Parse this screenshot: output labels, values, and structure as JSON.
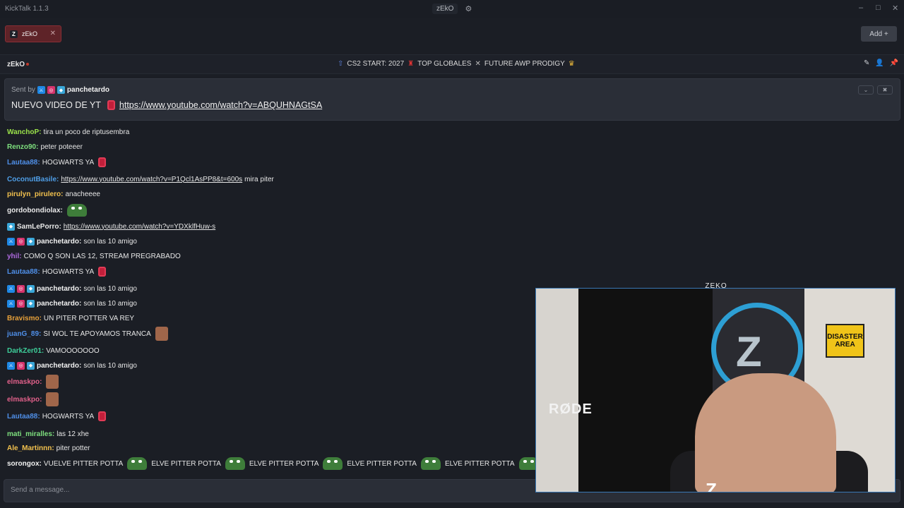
{
  "app": {
    "title": "KickTalk 1.1.3",
    "center_tab": "zEkO"
  },
  "tabs": [
    {
      "label": "zEkO",
      "avatar": "Z"
    }
  ],
  "add_button": "Add +",
  "channel": {
    "name": "zEkO",
    "stream_title": "CS2 START: 2027",
    "title_part2": "TOP GLOBALES",
    "title_part3": "FUTURE AWP PRODIGY",
    "title_icons": [
      "upload-arrow-icon",
      "red-trophy-icon",
      "swords-icon",
      "crown-icon"
    ]
  },
  "pinned": {
    "sent_by_label": "Sent by",
    "user": "panchetardo",
    "message": "NUEVO VIDEO DE YT",
    "link": "https://www.youtube.com/watch?v=ABQUHNAGtSA"
  },
  "messages": [
    {
      "user": "WanchoP:",
      "color": "#9be34a",
      "text": "tira un poco de riptusembra"
    },
    {
      "user": "Renzo90:",
      "color": "#7ee07e",
      "text": "peter poteeer"
    },
    {
      "user": "Lautaa88:",
      "color": "#4f8fe8",
      "text": "HOGWARTS YA"
    },
    {
      "user": "CoconutBasile:",
      "color": "#4f9fe8",
      "link": "https://www.youtube.com/watch?v=P1Qcl1AsPP8&t=600s",
      "text": "mira piter"
    },
    {
      "user": "pirulyn_pirulero:",
      "color": "#f2c14e",
      "text": "anacheeee"
    },
    {
      "user": "gordobondiolax:",
      "color": "#e8e8e8",
      "text": ""
    },
    {
      "user": "SamLePorro:",
      "color": "#e8e8e8",
      "link": "https://www.youtube.com/watch?v=YDXklfHuw-s"
    },
    {
      "user": "panchetardo:",
      "color": "#f2f2f2",
      "text": "son las 10 amigo"
    },
    {
      "user": "yhil:",
      "color": "#b06ae0",
      "text": "COMO Q SON LAS 12, STREAM PREGRABADO"
    },
    {
      "user": "Lautaa88:",
      "color": "#4f8fe8",
      "text": "HOGWARTS YA"
    },
    {
      "user": "panchetardo:",
      "color": "#f2f2f2",
      "text": "son las 10 amigo"
    },
    {
      "user": "panchetardo:",
      "color": "#f2f2f2",
      "text": "son las 10 amigo"
    },
    {
      "user": "Bravismo:",
      "color": "#e8a13a",
      "text": "UN PITER POTTER VA REY"
    },
    {
      "user": "juanG_89:",
      "color": "#4f8fe8",
      "text": "SI WOL TE APOYAMOS TRANCA"
    },
    {
      "user": "DarkZer01:",
      "color": "#3ecf9a",
      "text": "VAMOOOOOOO"
    },
    {
      "user": "panchetardo:",
      "color": "#f2f2f2",
      "text": "son las 10 amigo"
    },
    {
      "user": "elmaskpo:",
      "color": "#e0608a",
      "text": ""
    },
    {
      "user": "elmaskpo:",
      "color": "#e0608a",
      "text": ""
    },
    {
      "user": "Lautaa88:",
      "color": "#4f8fe8",
      "text": "HOGWARTS YA"
    },
    {
      "user": "mati_miralles:",
      "color": "#7ee07e",
      "text": "las 12 xhe"
    },
    {
      "user": "Ale_Martinnn:",
      "color": "#f2c14e",
      "text": "piter potter"
    },
    {
      "user": "sorongox:",
      "color": "#f2f2f2",
      "parts": [
        "VUELVE PITTER POTTA",
        "ELVE PITTER POTTA",
        "ELVE PITTER POTTA",
        "ELVE PITTER POTTA",
        "ELVE PITTER POTTA"
      ]
    }
  ],
  "input": {
    "placeholder": "Send a message..."
  },
  "stream": {
    "tag": "ZEKO",
    "mic_brand": "RØDE",
    "sign": "DISASTER AREA",
    "logo_letter": "Z"
  }
}
